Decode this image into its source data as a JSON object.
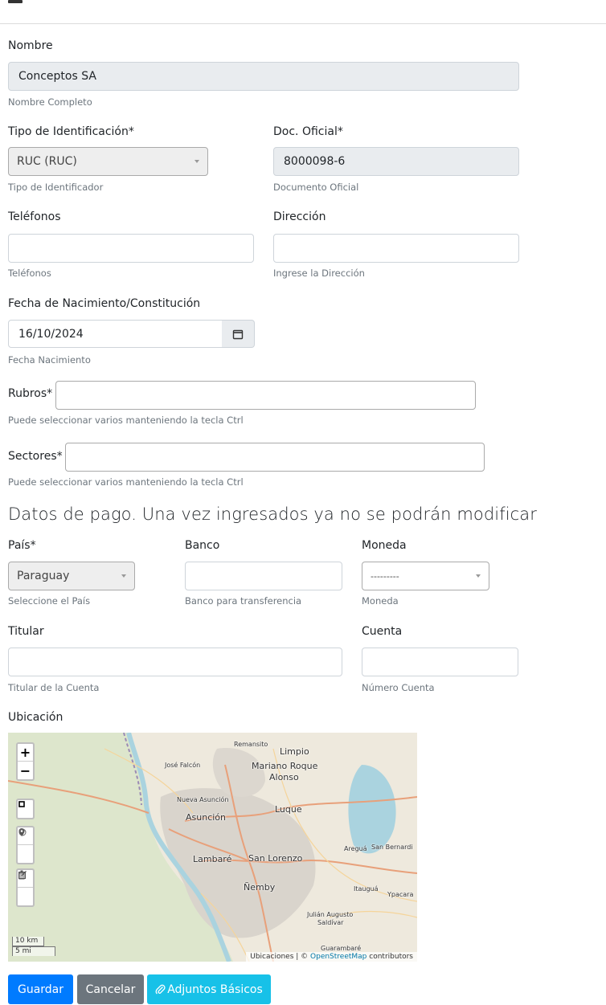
{
  "form": {
    "nombre": {
      "label": "Nombre",
      "value": "Conceptos SA",
      "help": "Nombre Completo"
    },
    "tipo_id": {
      "label": "Tipo de Identificación*",
      "value": "RUC (RUC)",
      "help": "Tipo de Identificador"
    },
    "doc_oficial": {
      "label": "Doc. Oficial*",
      "value": "8000098-6",
      "help": "Documento Oficial"
    },
    "telefonos": {
      "label": "Teléfonos",
      "value": "",
      "help": "Teléfonos"
    },
    "direccion": {
      "label": "Dirección",
      "value": "",
      "help": "Ingrese la Dirección"
    },
    "fecha": {
      "label": "Fecha de Nacimiento/Constitución",
      "value": "16/10/2024",
      "help": "Fecha Nacimiento"
    },
    "rubros": {
      "label": "Rubros*",
      "value": "",
      "help": "Puede seleccionar varios manteniendo la tecla Ctrl"
    },
    "sectores": {
      "label": "Sectores*",
      "value": "",
      "help": "Puede seleccionar varios manteniendo la tecla Ctrl"
    }
  },
  "payment": {
    "title": "Datos de pago. Una vez ingresados ya no se podrán modificar",
    "pais": {
      "label": "País*",
      "value": "Paraguay",
      "help": "Seleccione el País"
    },
    "banco": {
      "label": "Banco",
      "value": "",
      "help": "Banco para transferencia"
    },
    "moneda": {
      "label": "Moneda",
      "value": "---------",
      "help": "Moneda"
    },
    "titular": {
      "label": "Titular",
      "value": "",
      "help": "Titular de la Cuenta"
    },
    "cuenta": {
      "label": "Cuenta",
      "value": "",
      "help": "Número Cuenta"
    }
  },
  "location": {
    "label": "Ubicación",
    "map": {
      "zoom_in": "+",
      "zoom_out": "−",
      "scale_km": "10 km",
      "scale_mi": "5 mi",
      "attribution_prefix": "Ubicaciones | © ",
      "attribution_link": "OpenStreetMap",
      "attribution_suffix": " contributors",
      "places": {
        "remansito": "Remansito",
        "limpio": "Limpio",
        "jose_falcon": "José Falcón",
        "mariano": "Mariano Roque",
        "alonso": "Alonso",
        "nueva_asuncion": "Nueva Asunción",
        "luque": "Luque",
        "asuncion": "Asunción",
        "aregua": "Areguá",
        "san_bernardino": "San Bernardi",
        "lambare": "Lambaré",
        "san_lorenzo": "San Lorenzo",
        "nemby": "Ñemby",
        "itaugua": "Itauguá",
        "ypacarai": "Ypacara",
        "julian": "Julián Augusto",
        "saldivar": "Saldívar",
        "guarambare": "Guarambaré"
      },
      "controls": [
        "plus-icon",
        "minus-icon",
        "rectangle-icon",
        "marker-icon",
        "circle-icon",
        "edit-icon",
        "trash-icon"
      ]
    }
  },
  "actions": {
    "guardar": "Guardar",
    "cancelar": "Cancelar",
    "adjuntos": "Adjuntos Básicos"
  },
  "colors": {
    "primary": "#007bff",
    "secondary": "#6c757d",
    "info": "#17a2b8",
    "readonly_bg": "#e9ecef"
  }
}
